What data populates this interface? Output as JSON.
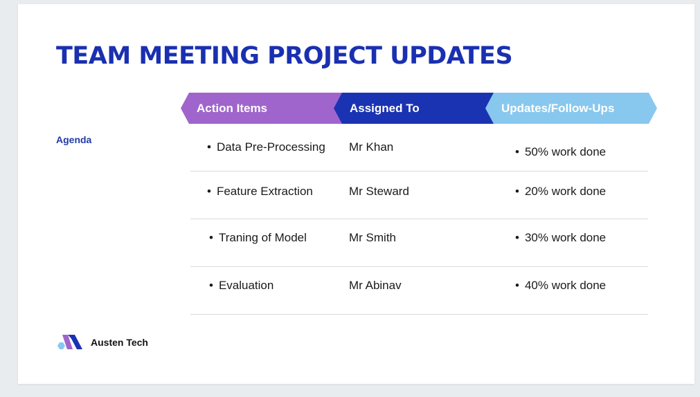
{
  "slide": {
    "title": "TEAM MEETING PROJECT UPDATES",
    "agenda_label": "Agenda",
    "headers": [
      "Action Items",
      "Assigned To",
      "Updates/Follow-Ups"
    ],
    "rows": [
      {
        "item": "Data Pre-Processing",
        "assigned": "Mr Khan",
        "update": "50% work done"
      },
      {
        "item": "Feature Extraction",
        "assigned": "Mr Steward",
        "update": "20% work done"
      },
      {
        "item": "Traning of Model",
        "assigned": "Mr Smith",
        "update": "30% work done"
      },
      {
        "item": "Evaluation",
        "assigned": "Mr Abinav",
        "update": "40% work done"
      }
    ],
    "brand": "Austen Tech"
  },
  "colors": {
    "title": "#1a30b0",
    "header_action": "#a065cc",
    "header_assigned": "#1a33b3",
    "header_updates": "#88c8ee"
  },
  "icons": {
    "logo": "austen-tech-logo-icon"
  }
}
